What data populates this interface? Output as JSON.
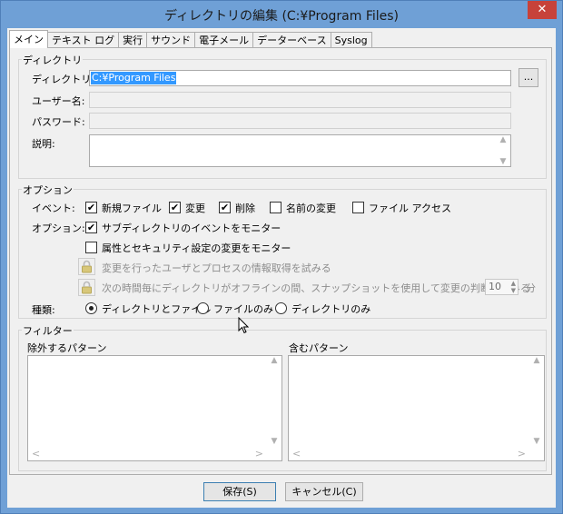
{
  "window": {
    "title": "ディレクトリの編集 (C:¥Program Files)",
    "close_glyph": "✕"
  },
  "tabs": [
    {
      "label": "メイン",
      "active": true
    },
    {
      "label": "テキスト ログ"
    },
    {
      "label": "実行"
    },
    {
      "label": "サウンド"
    },
    {
      "label": "電子メール"
    },
    {
      "label": "データーベース"
    },
    {
      "label": "Syslog"
    }
  ],
  "directory_group": {
    "title": "ディレクトリ",
    "directory_label": "ディレクトリ:",
    "directory_value": "C:¥Program Files",
    "browse_label": "...",
    "username_label": "ユーザー名:",
    "username_value": "",
    "password_label": "パスワード:",
    "password_value": "",
    "description_label": "説明:",
    "description_value": ""
  },
  "options_group": {
    "title": "オプション",
    "events_label": "イベント:",
    "events": [
      {
        "label": "新規ファイル",
        "checked": true
      },
      {
        "label": "変更",
        "checked": true
      },
      {
        "label": "削除",
        "checked": true
      },
      {
        "label": "名前の変更",
        "checked": false
      },
      {
        "label": "ファイル アクセス",
        "checked": false
      }
    ],
    "options_label": "オプション:",
    "option_subdir": {
      "label": "サブディレクトリのイベントをモニター",
      "checked": true
    },
    "option_security": {
      "label": "属性とセキュリティ設定の変更をモニター",
      "checked": false
    },
    "option_userinfo": {
      "label": "変更を行ったユーザとプロセスの情報取得を試みる",
      "enabled": false
    },
    "option_snapshot": {
      "label": "次の時間毎にディレクトリがオフラインの間、スナップショットを使用して変更の判断を試みる",
      "enabled": false
    },
    "snapshot_minutes": "10",
    "snapshot_unit": "分",
    "kind_label": "種類:",
    "kinds": [
      {
        "label": "ディレクトリとファイル",
        "selected": true
      },
      {
        "label": "ファイルのみ",
        "selected": false
      },
      {
        "label": "ディレクトリのみ",
        "selected": false
      }
    ]
  },
  "filter_group": {
    "title": "フィルター",
    "exclude_label": "除外するパターン",
    "include_label": "含むパターン"
  },
  "buttons": {
    "save": "保存(S)",
    "cancel": "キャンセル(C)"
  },
  "icons": {
    "lock": "lock-icon",
    "scroll_up": "▲",
    "scroll_down": "▼",
    "scroll_left": "<",
    "scroll_right": ">",
    "check": "✔"
  },
  "colors": {
    "titlebar": "#6fa0d6",
    "close_button": "#c7423a",
    "selection": "#3399ff"
  }
}
